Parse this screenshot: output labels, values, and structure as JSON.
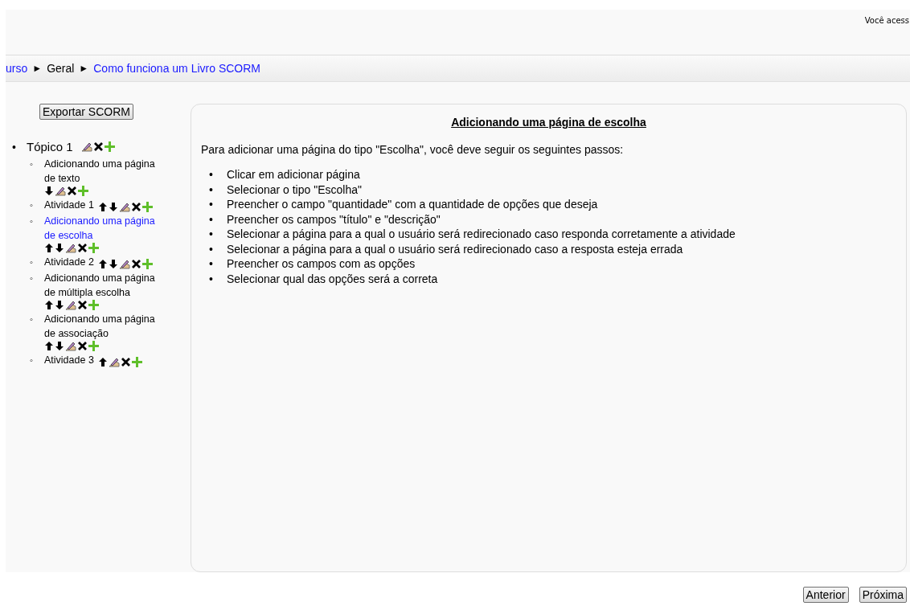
{
  "header": {
    "login_info": "Você acess"
  },
  "breadcrumb": [
    {
      "label": "urso",
      "link": true
    },
    {
      "label": "Geral",
      "link": false
    },
    {
      "label": "Como funciona um Livro SCORM",
      "link": true
    }
  ],
  "breadcrumb_separator": "►",
  "markers": {
    "topic": "•",
    "item": "◦",
    "step": "•"
  },
  "sidebar": {
    "export_button": "Exportar SCORM",
    "topics": [
      {
        "label": "Tópico 1",
        "actions": [
          {
            "kind": "edit"
          },
          {
            "kind": "delete"
          },
          {
            "kind": "add"
          }
        ],
        "children": [
          {
            "label": "Adicionando uma página de texto",
            "selected": false,
            "actions": [
              {
                "kind": "down"
              },
              {
                "kind": "edit"
              },
              {
                "kind": "delete"
              },
              {
                "kind": "add"
              }
            ]
          },
          {
            "label": "Atividade 1",
            "selected": false,
            "actions": [
              {
                "kind": "up"
              },
              {
                "kind": "down"
              },
              {
                "kind": "edit"
              },
              {
                "kind": "delete"
              },
              {
                "kind": "add"
              }
            ]
          },
          {
            "label": "Adicionando uma página de escolha",
            "selected": true,
            "actions": [
              {
                "kind": "up"
              },
              {
                "kind": "down"
              },
              {
                "kind": "edit"
              },
              {
                "kind": "delete"
              },
              {
                "kind": "add"
              }
            ]
          },
          {
            "label": "Atividade 2",
            "selected": false,
            "actions": [
              {
                "kind": "up"
              },
              {
                "kind": "down"
              },
              {
                "kind": "edit"
              },
              {
                "kind": "delete"
              },
              {
                "kind": "add"
              }
            ]
          },
          {
            "label": "Adicionando uma página de múltipla escolha",
            "selected": false,
            "actions": [
              {
                "kind": "up"
              },
              {
                "kind": "down"
              },
              {
                "kind": "edit"
              },
              {
                "kind": "delete"
              },
              {
                "kind": "add"
              }
            ]
          },
          {
            "label": "Adicionando uma página de associação",
            "selected": false,
            "actions": [
              {
                "kind": "up"
              },
              {
                "kind": "down"
              },
              {
                "kind": "edit"
              },
              {
                "kind": "delete"
              },
              {
                "kind": "add"
              }
            ]
          },
          {
            "label": "Atividade 3",
            "selected": false,
            "actions": [
              {
                "kind": "up"
              },
              {
                "kind": "edit"
              },
              {
                "kind": "delete"
              },
              {
                "kind": "add"
              }
            ]
          }
        ]
      }
    ]
  },
  "content": {
    "title": "Adicionando uma página de escolha",
    "intro": "Para adicionar uma página do tipo \"Escolha\", você deve seguir os seguintes passos:",
    "steps": [
      "Clicar em adicionar página",
      "Selecionar o tipo \"Escolha\"",
      "Preencher o campo \"quantidade\" com a quantidade de opções que deseja",
      "Preencher os campos \"título\" e \"descrição\"",
      "Selecionar a página para a qual o usuário será redirecionado caso responda corretamente a atividade",
      "Selecionar a página para a qual o usuário será redirecionado caso a resposta esteja errada",
      "Preencher os campos com as opções",
      "Selecionar qual das opções será a correta"
    ]
  },
  "buttons": [
    "Anterior",
    "Próxima"
  ]
}
